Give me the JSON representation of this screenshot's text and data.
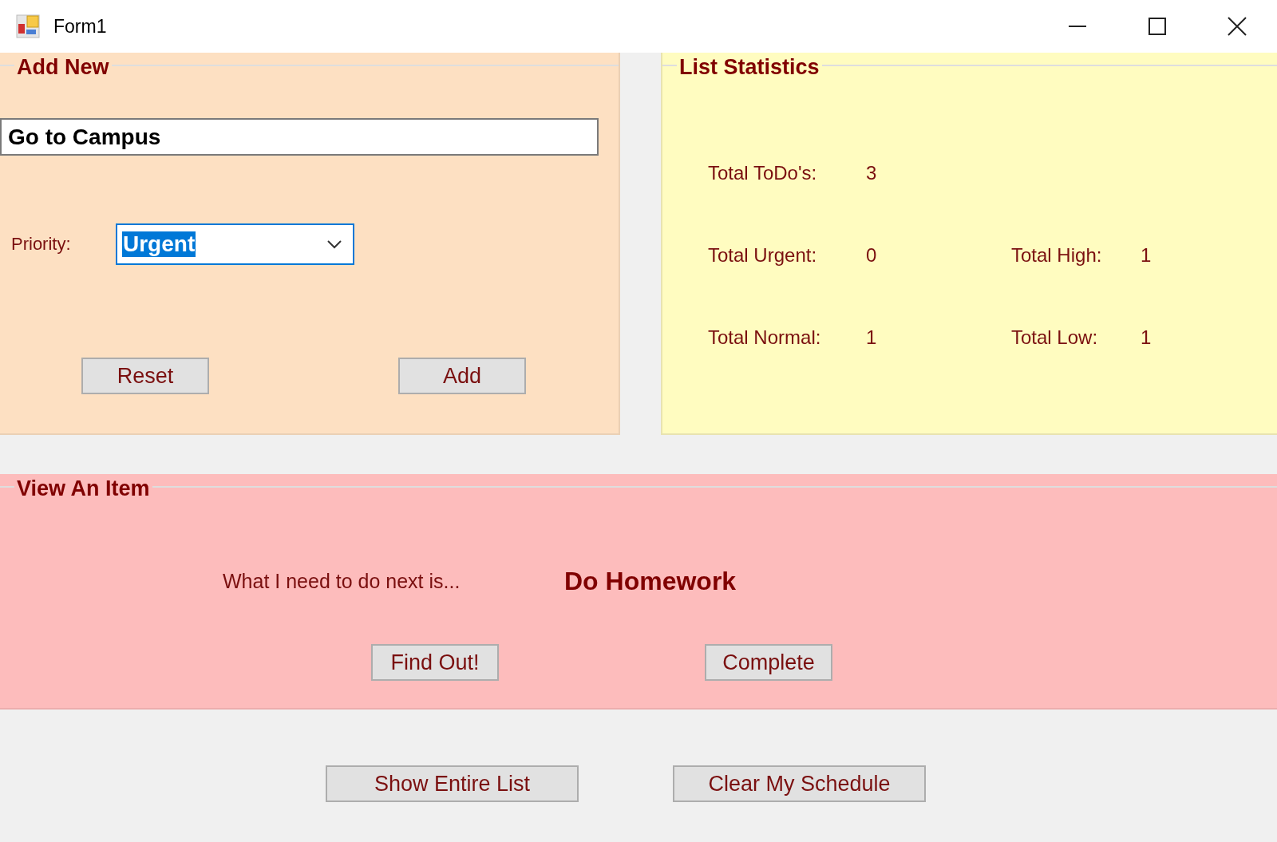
{
  "window": {
    "title": "Form1"
  },
  "add_new": {
    "title": "Add New",
    "task_field": {
      "value": "Go to Campus"
    },
    "priority": {
      "label": "Priority:",
      "value": "Urgent",
      "text_selected": true
    },
    "buttons": [
      "Reset",
      "Add"
    ]
  },
  "list_statistics": {
    "title": "List Statistics",
    "rows": [
      {
        "items": [
          {
            "label": "Total ToDo's:",
            "value": "3"
          }
        ]
      },
      {
        "items": [
          {
            "label": "Total Urgent:",
            "value": "0"
          },
          {
            "label": "Total High:",
            "value": "1"
          }
        ]
      },
      {
        "items": [
          {
            "label": "Total Normal:",
            "value": "1"
          },
          {
            "label": "Total Low:",
            "value": "1"
          }
        ]
      }
    ]
  },
  "view_item": {
    "title": "View An Item",
    "prompt": "What I need to do next is...",
    "next_item": "Do Homework",
    "buttons": [
      "Find Out!",
      "Complete"
    ]
  },
  "bottom_buttons": [
    "Show Entire List",
    "Clear My Schedule"
  ]
}
